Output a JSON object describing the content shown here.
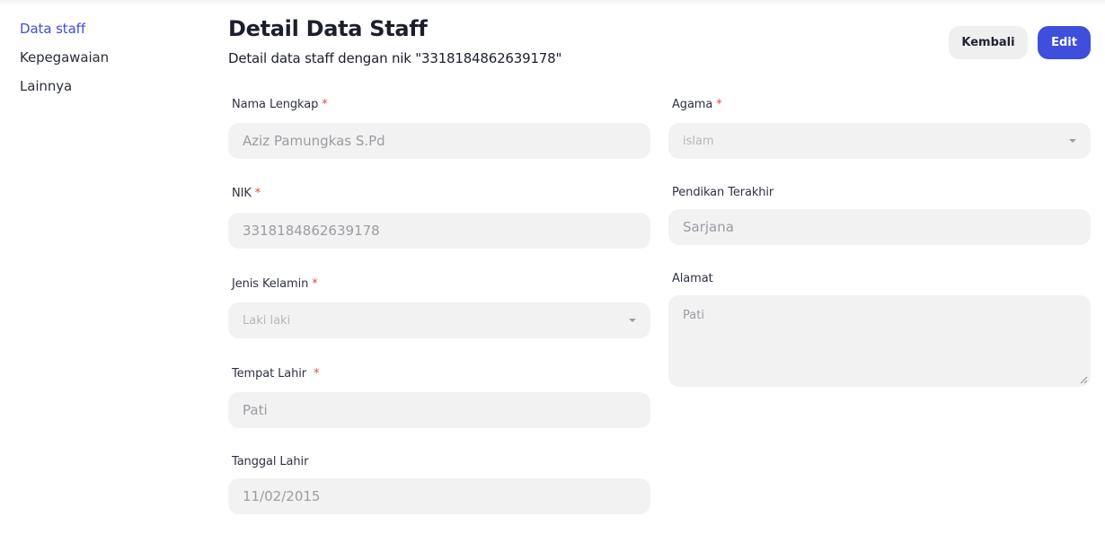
{
  "sidebar": {
    "items": [
      {
        "label": "Data staff",
        "active": true
      },
      {
        "label": "Kepegawaian",
        "active": false
      },
      {
        "label": "Lainnya",
        "active": false
      }
    ]
  },
  "header": {
    "title": "Detail Data Staff",
    "subtitle": "Detail data staff dengan nik \"3318184862639178\"",
    "back_label": "Kembali",
    "edit_label": "Edit"
  },
  "form": {
    "nama": {
      "label": "Nama Lengkap",
      "required": "*",
      "value": "Aziz Pamungkas S.Pd"
    },
    "nik": {
      "label": "NIK",
      "required": "*",
      "value": "3318184862639178"
    },
    "jenis_kelamin": {
      "label": "Jenis Kelamin",
      "required": "*",
      "value": "Laki laki"
    },
    "tempat_lahir": {
      "label": "Tempat Lahir",
      "required": "*",
      "value": "Pati"
    },
    "tanggal_lahir": {
      "label": "Tanggal Lahir",
      "value": "11/02/2015"
    },
    "agama": {
      "label": "Agama",
      "required": "*",
      "value": "islam"
    },
    "pendidikan": {
      "label": "Pendikan Terakhir",
      "value": "Sarjana"
    },
    "alamat": {
      "label": "Alamat",
      "value": "Pati"
    }
  },
  "colors": {
    "accent": "#3f4fdc",
    "required": "#e04a4a",
    "field_bg": "#f2f2f2"
  }
}
